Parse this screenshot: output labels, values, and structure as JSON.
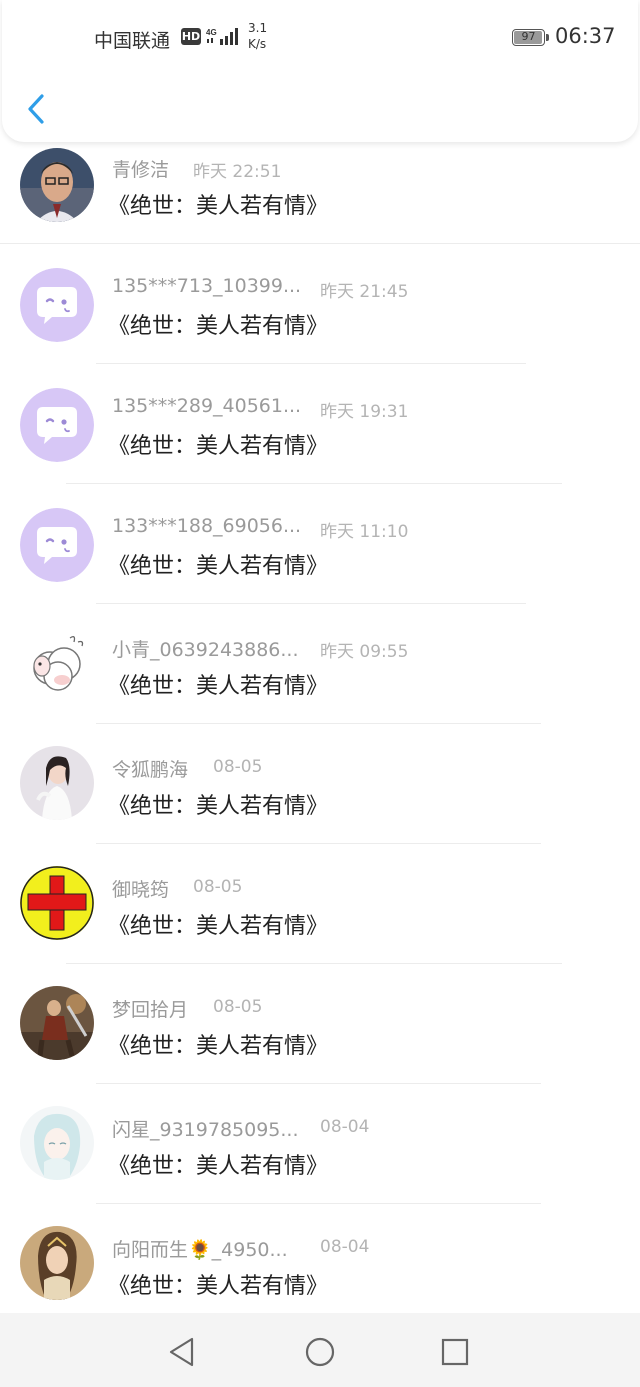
{
  "status_bar": {
    "carrier": "中国联通",
    "hd": "HD",
    "network": "4G",
    "speed_value": "3.1",
    "speed_unit": "K/s",
    "battery": "97",
    "time": "06:37"
  },
  "header": {
    "back_icon": "chevron-left-icon",
    "accent_color": "#2f9ee8"
  },
  "comments": [
    {
      "name": "青修洁",
      "time": "昨天 22:51",
      "text": "《绝世：美人若有情》",
      "avatar": "photo-man"
    },
    {
      "name": "135***713_10399...",
      "time": "昨天 21:45",
      "text": "《绝世：美人若有情》",
      "avatar": "default-chat"
    },
    {
      "name": "135***289_40561...",
      "time": "昨天 19:31",
      "text": "《绝世：美人若有情》",
      "avatar": "default-chat"
    },
    {
      "name": "133***188_69056...",
      "time": "昨天 11:10",
      "text": "《绝世：美人若有情》",
      "avatar": "default-chat"
    },
    {
      "name": "小青_0639243886...",
      "time": "昨天 09:55",
      "text": "《绝世：美人若有情》",
      "avatar": "cartoon-sheep"
    },
    {
      "name": "令狐鹏海",
      "time": "08-05",
      "text": "《绝世：美人若有情》",
      "avatar": "photo-woman"
    },
    {
      "name": "御晓筠",
      "time": "08-05",
      "text": "《绝世：美人若有情》",
      "avatar": "red-cross"
    },
    {
      "name": "梦回拾月",
      "time": "08-05",
      "text": "《绝世：美人若有情》",
      "avatar": "game-warrior"
    },
    {
      "name": "闪星_9319785095...",
      "time": "08-04",
      "text": "《绝世：美人若有情》",
      "avatar": "anime-girl"
    },
    {
      "name": "向阳而生🌻_4950...",
      "time": "08-04",
      "text": "《绝世：美人若有情》",
      "avatar": "fantasy-woman"
    }
  ],
  "nav_bar": {
    "back": "triangle-back-icon",
    "home": "circle-home-icon",
    "recents": "square-recents-icon"
  }
}
